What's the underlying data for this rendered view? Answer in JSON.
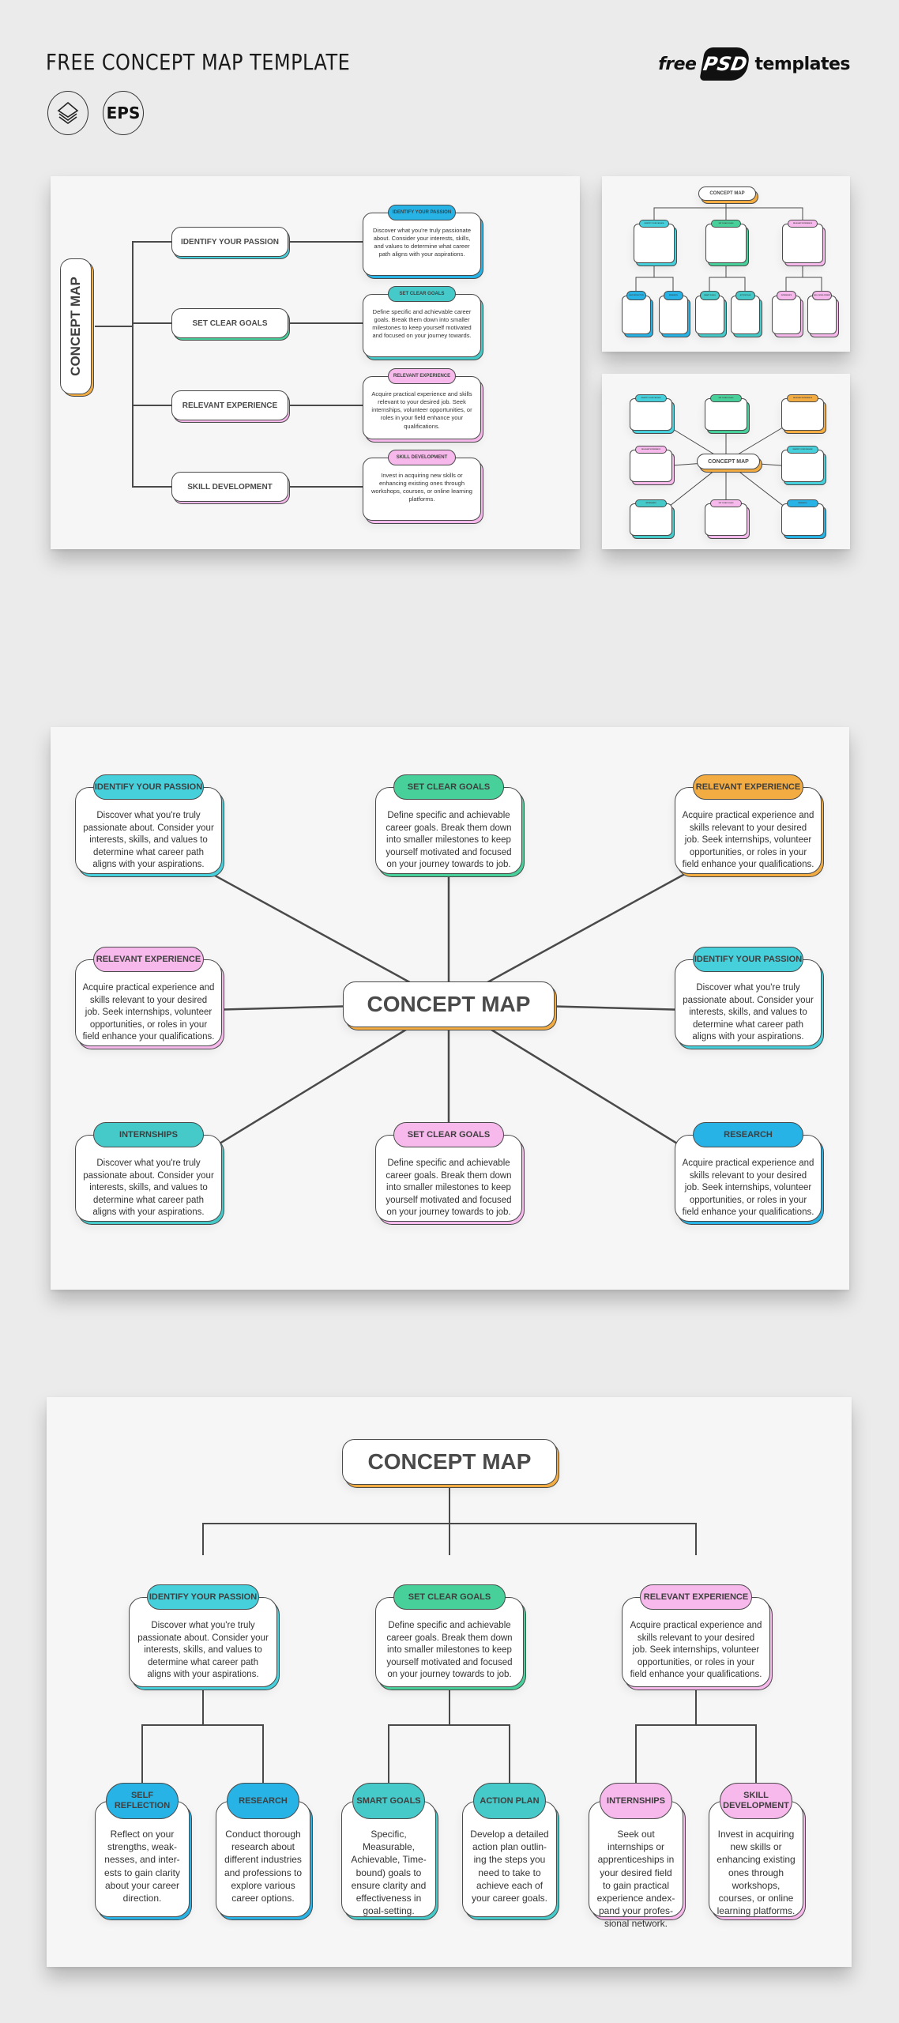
{
  "header": {
    "title": "FREE CONCEPT MAP TEMPLATE",
    "badges": [
      {
        "icon": "layers-icon",
        "label": ""
      },
      {
        "icon": "eps-icon",
        "label": "EPS"
      }
    ],
    "brand": {
      "left": "free",
      "mark": "PSD",
      "right": "templates"
    }
  },
  "colors": {
    "page_bg": "#ebebeb",
    "panel_bg": "#f6f6f6",
    "blue": "#27b3e6",
    "cyan": "#45d0dc",
    "teal": "#45c9c9",
    "green": "#47d09a",
    "orange": "#f2ac42",
    "pink": "#f7b8ec",
    "line": "#4a4a4a"
  },
  "panel1": {
    "root": "CONCEPT MAP",
    "branches": [
      {
        "label": "IDENTIFY YOUR PASSION",
        "tag": "IDENTIFY YOUR PASSION",
        "color": "#27b3e6",
        "accent": "#45d0dc",
        "text": "Discover what you're truly passionate about. Consider your interests, skills, and values to determine what career path aligns with your aspirations."
      },
      {
        "label": "SET CLEAR GOALS",
        "tag": "SET CLEAR GOALS",
        "color": "#45c9c9",
        "accent": "#47d09a",
        "text": "Define specific and achievable career goals. Break them down into smaller milestones to keep yourself motivated and focused on your journey towards."
      },
      {
        "label": "RELEVANT EXPERIENCE",
        "tag": "RELEVANT EXPERIENCE",
        "color": "#f7b8ec",
        "accent": "#f7b8ec",
        "text": "Acquire practical experience and skills relevant to your desired job. Seek internships, volunteer opportunities, or roles in your field enhance your qualifications."
      },
      {
        "label": "SKILL DEVELOPMENT",
        "tag": "SKILL DEVELOPMENT",
        "color": "#f7b8ec",
        "accent": "#f7b8ec",
        "text": "Invest in acquiring new skills or enhancing existing ones through workshops, courses, or online learning platforms."
      }
    ]
  },
  "thumb1": {
    "root": "CONCEPT MAP",
    "top": [
      {
        "tag": "IDENTIFY YOUR PASSION",
        "color": "#45d0dc"
      },
      {
        "tag": "SET CLEAR GOALS",
        "color": "#47d09a"
      },
      {
        "tag": "RELEVANT EXPERIENCE",
        "color": "#f7b8ec"
      }
    ],
    "bottom": [
      {
        "tag": "SELF REFLECTION",
        "color": "#27b3e6"
      },
      {
        "tag": "RESEARCH",
        "color": "#27b3e6"
      },
      {
        "tag": "SMART GOALS",
        "color": "#45c9c9"
      },
      {
        "tag": "ACTION PLAN",
        "color": "#45c9c9"
      },
      {
        "tag": "INTERNSHIPS",
        "color": "#f7b8ec"
      },
      {
        "tag": "SKILL DEVELOPMENT",
        "color": "#f7b8ec"
      }
    ]
  },
  "thumb2": {
    "root": "CONCEPT MAP",
    "nodes": [
      {
        "tag": "IDENTIFY YOUR PASSION",
        "color": "#45d0dc"
      },
      {
        "tag": "SET CLEAR GOALS",
        "color": "#47d09a"
      },
      {
        "tag": "RELEVANT EXPERIENCE",
        "color": "#f2ac42"
      },
      {
        "tag": "RELEVANT EXPERIENCE",
        "color": "#f7b8ec"
      },
      {
        "tag": "IDENTIFY YOUR PASSION",
        "color": "#45d0dc"
      },
      {
        "tag": "INTERNSHIPS",
        "color": "#45c9c9"
      },
      {
        "tag": "SET CLEAR GOALS",
        "color": "#f7b8ec"
      },
      {
        "tag": "RESEARCH",
        "color": "#27b3e6"
      }
    ]
  },
  "panel2": {
    "root": "CONCEPT MAP",
    "nodes": [
      {
        "tag": "IDENTIFY YOUR PASSION",
        "color": "#45d0dc",
        "text": "Discover what you're truly passionate about. Consider your interests, skills, and values to determine what career path aligns with your aspirations."
      },
      {
        "tag": "SET CLEAR GOALS",
        "color": "#47d09a",
        "text": "Define specific and achievable career goals. Break them down into smaller milestones to keep yourself motivated and focused on your journey towards to job."
      },
      {
        "tag": "RELEVANT EXPERIENCE",
        "color": "#f2ac42",
        "text": "Acquire practical experience and skills relevant to your desired job. Seek internships, volunteer opportunities, or roles in your field enhance your qualifications."
      },
      {
        "tag": "RELEVANT EXPERIENCE",
        "color": "#f7b8ec",
        "text": "Acquire practical experience and skills relevant to your desired job. Seek internships, volunteer opportunities, or roles in your field enhance your qualifications."
      },
      {
        "tag": "IDENTIFY YOUR PASSION",
        "color": "#45d0dc",
        "text": "Discover what you're truly passionate about. Consider your interests, skills, and values to determine what career path aligns with your aspirations."
      },
      {
        "tag": "INTERNSHIPS",
        "color": "#45c9c9",
        "text": "Discover what you're truly passionate about. Consider your interests, skills, and values to determine what career path aligns with your aspirations."
      },
      {
        "tag": "SET CLEAR GOALS",
        "color": "#f7b8ec",
        "text": "Define specific and achievable career goals. Break them down into smaller milestones to keep yourself motivated and focused on your journey towards to job."
      },
      {
        "tag": "RESEARCH",
        "color": "#27b3e6",
        "text": "Acquire practical experience and skills relevant to your desired job. Seek internships, volunteer opportunities, or roles in your field enhance your qualifications."
      }
    ]
  },
  "panel3": {
    "root": "CONCEPT MAP",
    "top": [
      {
        "tag": "IDENTIFY YOUR PASSION",
        "color": "#45d0dc",
        "text": "Discover what you're truly passionate about. Consider your interests, skills, and values to determine what career path aligns with your aspirations."
      },
      {
        "tag": "SET CLEAR GOALS",
        "color": "#47d09a",
        "text": "Define specific and achievable career goals. Break them down into smaller milestones to keep yourself motivated and focused on your journey towards to job."
      },
      {
        "tag": "RELEVANT EXPERIENCE",
        "color": "#f7b8ec",
        "text": "Acquire practical experience and skills relevant to your desired job. Seek internships, volunteer opportunities, or roles in your field enhance your qualifications."
      }
    ],
    "bottom": [
      {
        "tag": "SELF REFLECTION",
        "color": "#27b3e6",
        "text": "Reflect on your strengths, weak-nesses, and inter-ests to gain clarity about your career direction."
      },
      {
        "tag": "RESEARCH",
        "color": "#27b3e6",
        "text": "Conduct thorough research about different industries and professions to explore various career options."
      },
      {
        "tag": "SMART GOALS",
        "color": "#45c9c9",
        "text": "Specific, Measurable, Achievable, Time-bound) goals to ensure clarity and effectiveness in goal-setting."
      },
      {
        "tag": "ACTION PLAN",
        "color": "#45c9c9",
        "text": "Develop a detailed action plan outlin-ing the steps you need to take to achieve each of your career goals."
      },
      {
        "tag": "INTERNSHIPS",
        "color": "#f7b8ec",
        "text": "Seek out internships or apprenticeships in your desired field to gain practical experience andex-pand your profes-sional network."
      },
      {
        "tag": "SKILL DEVELOPMENT",
        "color": "#f7b8ec",
        "text": "Invest in acquiring new skills or enhancing existing ones through workshops, courses, or online learning platforms."
      }
    ]
  }
}
